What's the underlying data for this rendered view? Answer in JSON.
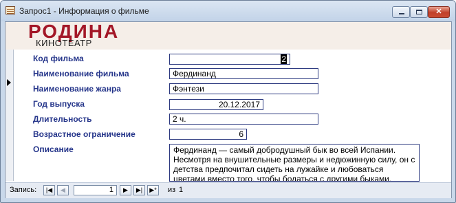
{
  "window": {
    "title": "Запрос1 - Информация о фильме",
    "controls": {
      "minimize": "minimize",
      "maximize": "maximize",
      "close": "✕"
    }
  },
  "header": {
    "logo_main": "РОДИНА",
    "logo_sub": "КИНОТЕАТР",
    "logo_color": "#a31727"
  },
  "fields": {
    "film_code": {
      "label": "Код фильма",
      "value": "2"
    },
    "film_name": {
      "label": "Наименование фильма",
      "value": "Фердинанд"
    },
    "genre_name": {
      "label": "Наименование жанра",
      "value": "Фэнтези"
    },
    "release_year": {
      "label": "Год выпуска",
      "value": "20.12.2017"
    },
    "duration": {
      "label": "Длительность",
      "value": "2 ч."
    },
    "age_limit": {
      "label": "Возрастное ограничение",
      "value": "6"
    },
    "description": {
      "label": "Описание",
      "value": "Фердинанд — самый добродушный бык во всей Испании. Несмотря на внушительные размеры и недюжинную силу, он с детства предпочитал сидеть на лужайке и любоваться цветами вместо того, чтобы бодаться с другими быками."
    }
  },
  "navigation": {
    "label": "Запись:",
    "current": "1",
    "of_label": "из",
    "total": "1",
    "buttons": {
      "first": "|◀",
      "prev": "◀",
      "next": "▶",
      "last": "▶|",
      "new": "▶*"
    }
  },
  "colors": {
    "label_text": "#25358a",
    "field_border": "#2d3a80",
    "header_bg": "#f5eee8"
  }
}
